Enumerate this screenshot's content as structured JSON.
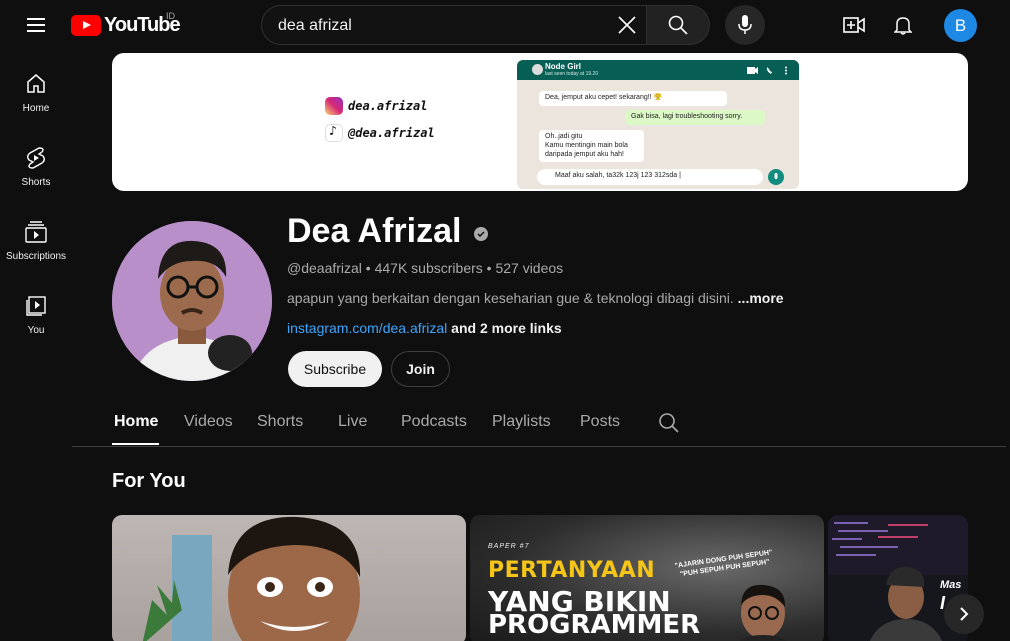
{
  "topbar": {
    "logo_text": "YouTube",
    "region": "ID",
    "search_value": "dea afrizal",
    "account_initial": "B"
  },
  "nav": [
    {
      "label": "Home",
      "icon": "home-icon"
    },
    {
      "label": "Shorts",
      "icon": "shorts-icon"
    },
    {
      "label": "Subscriptions",
      "icon": "subscriptions-icon"
    },
    {
      "label": "You",
      "icon": "you-icon"
    }
  ],
  "banner": {
    "instagram_handle": "dea.afrizal",
    "tiktok_handle": "@dea.afrizal",
    "chat": {
      "contact": "Node Girl",
      "status": "last seen today at 19.20",
      "msg1": "Dea, jemput aku cepet! sekarang!! 😤",
      "msg2": "Gak bisa, lagi troubleshooting sorry.",
      "msg3": "Oh..jadi gitu\nKamu mentingin main bola\ndaripada jemput aku hah!",
      "input": "Maaf aku salah, ta32k 123j 123 312sda |"
    }
  },
  "channel": {
    "name": "Dea Afrizal",
    "meta": "@deaafrizal • 447K subscribers • 527 videos",
    "description": "apapun yang berkaitan dengan keseharian gue & teknologi dibagi disini. ",
    "description_more": "...more",
    "link": "instagram.com/dea.afrizal",
    "more_links": " and 2 more links",
    "subscribe_label": "Subscribe",
    "join_label": "Join"
  },
  "tabs": [
    "Home",
    "Videos",
    "Shorts",
    "Live",
    "Podcasts",
    "Playlists",
    "Posts"
  ],
  "section": {
    "title": "For You"
  },
  "thumbnails": {
    "t2_kicker": "BAPER #7",
    "t2_line1": "PERTANYAAN",
    "t2_line2": "YANG BIKIN",
    "t2_line3": "PROGRAMMER",
    "t2_quote": "\"AJARIN DONG PUH SEPUH\"\n\"PUH SEPUH PUH SEPUH\"",
    "t3_line1": "Mas",
    "t3_line2": "I"
  },
  "colors": {
    "background": "#0f0f0f",
    "accent_red": "#ff0000",
    "link_blue": "#3ea6ff",
    "avatar_blue": "#1e88e5"
  }
}
